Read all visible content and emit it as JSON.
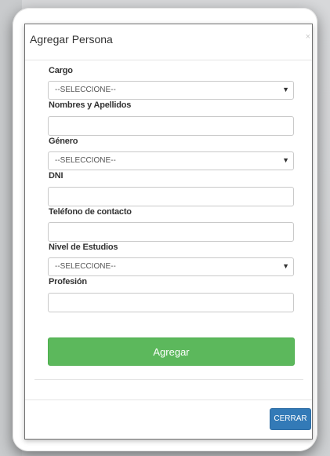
{
  "modal": {
    "title": "Agregar Persona",
    "close_symbol": "×"
  },
  "form": {
    "cargo": {
      "label": "Cargo",
      "selected": "--SELECCIONE--"
    },
    "nombres": {
      "label": "Nombres y Apellidos",
      "value": ""
    },
    "genero": {
      "label": "Género",
      "selected": "--SELECCIONE--"
    },
    "dni": {
      "label": "DNI",
      "value": ""
    },
    "telefono": {
      "label": "Teléfono de contacto",
      "value": ""
    },
    "nivel_estudios": {
      "label": "Nivel de Estudios",
      "selected": "--SELECCIONE--"
    },
    "profesion": {
      "label": "Profesión",
      "value": ""
    },
    "dropdown_icon": "chevron-down-icon",
    "submit_label": "Agregar",
    "submit_color": "#5cb85c"
  },
  "footer": {
    "close_label": "CERRAR",
    "close_color": "#337ab7"
  }
}
